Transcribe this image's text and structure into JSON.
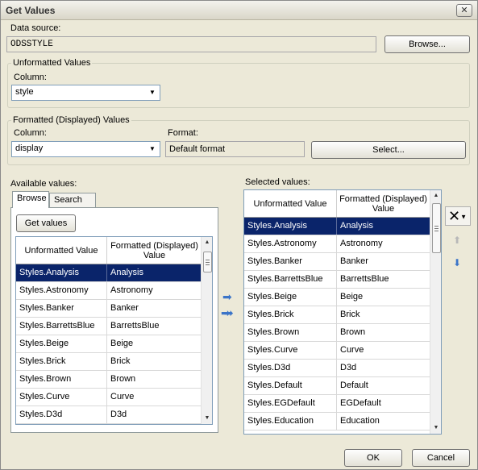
{
  "window": {
    "title": "Get Values",
    "close_label": "✕"
  },
  "data_source": {
    "label": "Data source:",
    "value": "ODSSTYLE",
    "browse_label": "Browse..."
  },
  "unformatted": {
    "group_label": "Unformatted Values",
    "column_label": "Column:",
    "column_value": "style"
  },
  "formatted": {
    "group_label": "Formatted (Displayed) Values",
    "column_label": "Column:",
    "column_value": "display",
    "format_label": "Format:",
    "format_value": "Default format",
    "select_label": "Select..."
  },
  "available": {
    "label": "Available values:",
    "tabs": [
      "Browse",
      "Search"
    ],
    "get_values_label": "Get values",
    "columns": [
      "Unformatted Value",
      "Formatted (Displayed) Value"
    ],
    "rows": [
      [
        "Styles.Analysis",
        "Analysis"
      ],
      [
        "Styles.Astronomy",
        "Astronomy"
      ],
      [
        "Styles.Banker",
        "Banker"
      ],
      [
        "Styles.BarrettsBlue",
        "BarrettsBlue"
      ],
      [
        "Styles.Beige",
        "Beige"
      ],
      [
        "Styles.Brick",
        "Brick"
      ],
      [
        "Styles.Brown",
        "Brown"
      ],
      [
        "Styles.Curve",
        "Curve"
      ],
      [
        "Styles.D3d",
        "D3d"
      ]
    ],
    "selected_row": 0
  },
  "selected": {
    "label": "Selected values:",
    "columns": [
      "Unformatted Value",
      "Formatted (Displayed) Value"
    ],
    "rows": [
      [
        "Styles.Analysis",
        "Analysis"
      ],
      [
        "Styles.Astronomy",
        "Astronomy"
      ],
      [
        "Styles.Banker",
        "Banker"
      ],
      [
        "Styles.BarrettsBlue",
        "BarrettsBlue"
      ],
      [
        "Styles.Beige",
        "Beige"
      ],
      [
        "Styles.Brick",
        "Brick"
      ],
      [
        "Styles.Brown",
        "Brown"
      ],
      [
        "Styles.Curve",
        "Curve"
      ],
      [
        "Styles.D3d",
        "D3d"
      ],
      [
        "Styles.Default",
        "Default"
      ],
      [
        "Styles.EGDefault",
        "EGDefault"
      ],
      [
        "Styles.Education",
        "Education"
      ]
    ],
    "selected_row": 0
  },
  "buttons": {
    "ok": "OK",
    "cancel": "Cancel"
  },
  "colors": {
    "selection": "#0a246a",
    "dialog_bg": "#ece9d8",
    "arrow_blue": "#3b74c8"
  }
}
